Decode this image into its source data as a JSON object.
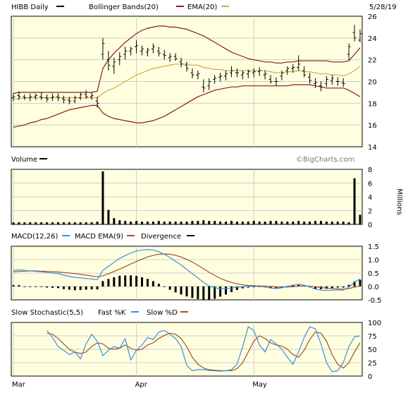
{
  "header": {
    "ticker_label": "HIBB Daily",
    "bollinger_label": "Bollinger Bands(20)",
    "ema_label": "EMA(20)",
    "date": "5/28/19",
    "watermark": "©BigCharts.com"
  },
  "colors": {
    "plot_bg": "#ffffe0",
    "grid": "#cccccc",
    "price_bar": "#000000",
    "bollinger": "#8b1a1a",
    "ema": "#d4a84a",
    "volume_bar": "#000000",
    "macd": "#3a8fe0",
    "macd_ema": "#a0522d",
    "divergence": "#000000",
    "fast_k": "#3a8fe0",
    "slow_d": "#a0522d"
  },
  "panels": {
    "volume_title": "Volume",
    "volume_unit": "Millions",
    "macd_title": "MACD(12,26)",
    "macd_ema_label": "MACD EMA(9)",
    "divergence_label": "Divergence",
    "stoch_title": "Slow Stochastic(5,5)",
    "fast_k_label": "Fast %K",
    "slow_d_label": "Slow %D"
  },
  "x_axis": {
    "labels": [
      {
        "text": "Mar",
        "index": 0
      },
      {
        "text": "Apr",
        "index": 22
      },
      {
        "text": "May",
        "index": 43
      }
    ],
    "n": 63
  },
  "chart_data": [
    {
      "type": "ohlc",
      "title": "HIBB Daily",
      "ylim": [
        14,
        26
      ],
      "yticks": [
        14,
        16,
        18,
        20,
        22,
        24,
        26
      ],
      "ohlc": [
        [
          18.5,
          18.9,
          18.2,
          18.6
        ],
        [
          18.7,
          19.1,
          18.3,
          18.6
        ],
        [
          18.6,
          18.8,
          18.3,
          18.5
        ],
        [
          18.5,
          18.9,
          18.2,
          18.6
        ],
        [
          18.6,
          18.9,
          18.3,
          18.7
        ],
        [
          18.6,
          19.0,
          18.3,
          18.5
        ],
        [
          18.5,
          18.8,
          18.1,
          18.4
        ],
        [
          18.5,
          18.9,
          18.2,
          18.6
        ],
        [
          18.6,
          18.9,
          18.2,
          18.5
        ],
        [
          18.4,
          18.7,
          18.0,
          18.3
        ],
        [
          18.3,
          18.6,
          17.9,
          18.2
        ],
        [
          18.2,
          18.7,
          18.0,
          18.5
        ],
        [
          18.5,
          19.0,
          18.3,
          18.8
        ],
        [
          18.8,
          19.2,
          18.4,
          18.6
        ],
        [
          18.6,
          19.0,
          18.3,
          18.7
        ],
        [
          18.2,
          18.6,
          17.6,
          18.0
        ],
        [
          22.5,
          24.0,
          22.0,
          23.5
        ],
        [
          22.0,
          22.8,
          21.0,
          21.5
        ],
        [
          21.4,
          22.2,
          20.7,
          21.8
        ],
        [
          22.0,
          22.7,
          21.5,
          22.3
        ],
        [
          22.5,
          23.2,
          22.0,
          22.8
        ],
        [
          22.8,
          23.2,
          22.4,
          23.0
        ],
        [
          23.2,
          23.8,
          22.6,
          23.3
        ],
        [
          22.8,
          23.3,
          22.4,
          23.0
        ],
        [
          22.7,
          23.1,
          22.3,
          22.9
        ],
        [
          23.0,
          23.5,
          22.6,
          23.2
        ],
        [
          22.8,
          23.2,
          22.3,
          22.6
        ],
        [
          22.5,
          22.9,
          22.0,
          22.4
        ],
        [
          22.2,
          22.6,
          21.8,
          22.3
        ],
        [
          22.3,
          22.6,
          21.9,
          22.1
        ],
        [
          21.8,
          22.2,
          21.3,
          21.6
        ],
        [
          21.5,
          21.8,
          20.9,
          21.2
        ],
        [
          20.8,
          21.2,
          20.3,
          20.6
        ],
        [
          20.6,
          21.0,
          20.2,
          20.7
        ],
        [
          19.5,
          20.2,
          19.0,
          19.4
        ],
        [
          19.6,
          20.3,
          19.2,
          20.0
        ],
        [
          20.2,
          20.6,
          19.8,
          20.3
        ],
        [
          20.4,
          20.8,
          20.0,
          20.5
        ],
        [
          20.5,
          21.0,
          20.1,
          20.7
        ],
        [
          20.8,
          21.4,
          20.4,
          21.0
        ],
        [
          20.8,
          21.2,
          20.4,
          20.8
        ],
        [
          20.6,
          21.0,
          20.2,
          20.8
        ],
        [
          20.7,
          21.1,
          20.3,
          20.9
        ],
        [
          20.8,
          21.2,
          20.4,
          20.9
        ],
        [
          20.9,
          21.3,
          20.5,
          21.0
        ],
        [
          20.6,
          21.0,
          20.2,
          20.7
        ],
        [
          20.2,
          20.6,
          19.8,
          20.0
        ],
        [
          20.0,
          20.4,
          19.6,
          20.0
        ],
        [
          20.5,
          21.0,
          20.1,
          20.8
        ],
        [
          21.0,
          21.4,
          20.6,
          21.2
        ],
        [
          21.2,
          21.6,
          20.8,
          21.3
        ],
        [
          21.3,
          22.4,
          21.0,
          21.6
        ],
        [
          21.0,
          21.4,
          20.4,
          20.6
        ],
        [
          20.4,
          20.8,
          19.8,
          20.1
        ],
        [
          19.8,
          20.3,
          19.4,
          19.9
        ],
        [
          19.6,
          20.0,
          19.1,
          19.5
        ],
        [
          19.8,
          20.5,
          19.5,
          20.2
        ],
        [
          20.1,
          20.6,
          19.7,
          20.3
        ],
        [
          20.0,
          20.4,
          19.6,
          20.0
        ],
        [
          19.9,
          20.3,
          19.5,
          19.8
        ],
        [
          22.5,
          23.5,
          22.0,
          23.2
        ],
        [
          24.5,
          25.2,
          23.7,
          24.0
        ],
        [
          23.8,
          24.8,
          23.6,
          24.4
        ]
      ],
      "bollinger_upper": [
        18.9,
        19.0,
        19.0,
        19.0,
        19.0,
        19.0,
        19.0,
        19.0,
        19.0,
        19.0,
        19.0,
        19.0,
        19.0,
        19.0,
        19.0,
        19.1,
        21.2,
        22.0,
        22.6,
        23.1,
        23.6,
        24.0,
        24.4,
        24.7,
        24.9,
        25.0,
        25.1,
        25.1,
        25.0,
        25.0,
        24.9,
        24.8,
        24.6,
        24.4,
        24.2,
        23.9,
        23.6,
        23.3,
        23.0,
        22.7,
        22.5,
        22.3,
        22.1,
        22.0,
        21.9,
        21.8,
        21.8,
        21.7,
        21.7,
        21.8,
        21.8,
        21.9,
        21.9,
        21.9,
        21.9,
        21.9,
        21.9,
        21.8,
        21.8,
        21.8,
        21.9,
        22.5,
        23.1
      ],
      "bollinger_lower": [
        15.8,
        15.9,
        16.0,
        16.2,
        16.3,
        16.5,
        16.6,
        16.8,
        17.0,
        17.2,
        17.4,
        17.5,
        17.6,
        17.7,
        17.8,
        17.8,
        17.1,
        16.8,
        16.6,
        16.5,
        16.4,
        16.3,
        16.2,
        16.2,
        16.3,
        16.4,
        16.6,
        16.8,
        17.1,
        17.4,
        17.7,
        18.0,
        18.3,
        18.6,
        18.8,
        19.0,
        19.2,
        19.3,
        19.4,
        19.5,
        19.5,
        19.6,
        19.6,
        19.6,
        19.6,
        19.6,
        19.6,
        19.6,
        19.6,
        19.6,
        19.7,
        19.7,
        19.7,
        19.7,
        19.6,
        19.5,
        19.4,
        19.4,
        19.4,
        19.4,
        19.2,
        18.9,
        18.6
      ],
      "ema": [
        18.4,
        18.4,
        18.5,
        18.5,
        18.5,
        18.5,
        18.5,
        18.5,
        18.5,
        18.5,
        18.5,
        18.5,
        18.5,
        18.5,
        18.5,
        18.5,
        18.9,
        19.2,
        19.4,
        19.7,
        20.0,
        20.3,
        20.6,
        20.8,
        21.0,
        21.2,
        21.3,
        21.4,
        21.5,
        21.6,
        21.6,
        21.6,
        21.5,
        21.5,
        21.3,
        21.2,
        21.1,
        21.1,
        21.0,
        21.0,
        21.0,
        21.0,
        21.0,
        21.0,
        21.0,
        21.0,
        20.9,
        20.8,
        20.8,
        20.9,
        20.9,
        21.0,
        20.9,
        20.9,
        20.8,
        20.7,
        20.7,
        20.6,
        20.6,
        20.5,
        20.7,
        21.0,
        21.4
      ]
    },
    {
      "type": "bar",
      "title": "Volume",
      "ylabel": "Millions",
      "ylim": [
        0,
        8
      ],
      "yticks": [
        0,
        2,
        4,
        6,
        8
      ],
      "values": [
        0.3,
        0.3,
        0.3,
        0.3,
        0.3,
        0.3,
        0.3,
        0.3,
        0.3,
        0.3,
        0.3,
        0.3,
        0.3,
        0.3,
        0.3,
        0.4,
        7.7,
        2.1,
        0.9,
        0.6,
        0.5,
        0.4,
        0.5,
        0.4,
        0.4,
        0.4,
        0.5,
        0.4,
        0.4,
        0.4,
        0.4,
        0.4,
        0.5,
        0.5,
        0.6,
        0.5,
        0.5,
        0.4,
        0.4,
        0.5,
        0.4,
        0.4,
        0.4,
        0.5,
        0.4,
        0.4,
        0.5,
        0.5,
        0.4,
        0.4,
        0.4,
        0.5,
        0.4,
        0.4,
        0.5,
        0.5,
        0.4,
        0.4,
        0.4,
        0.4,
        0.3,
        6.7,
        1.4
      ]
    },
    {
      "type": "line",
      "title": "MACD(12,26)",
      "ylim": [
        -0.5,
        1.5
      ],
      "yticks": [
        -0.5,
        0.0,
        0.5,
        1.0,
        1.5
      ],
      "ytick_labels": [
        "-0.5",
        "0.0",
        "0.5",
        "1.0",
        "1.5"
      ],
      "series": [
        {
          "name": "MACD(12,26)",
          "values": [
            0.6,
            0.62,
            0.6,
            0.58,
            0.56,
            0.55,
            0.52,
            0.5,
            0.48,
            0.42,
            0.38,
            0.34,
            0.32,
            0.3,
            0.28,
            0.25,
            0.6,
            0.75,
            0.9,
            1.05,
            1.15,
            1.25,
            1.32,
            1.36,
            1.38,
            1.36,
            1.3,
            1.2,
            1.08,
            0.94,
            0.8,
            0.64,
            0.48,
            0.32,
            0.15,
            0.02,
            -0.05,
            -0.08,
            -0.08,
            -0.06,
            -0.03,
            -0.01,
            0.0,
            0.0,
            0.01,
            -0.02,
            -0.06,
            -0.08,
            -0.05,
            0.0,
            0.05,
            0.08,
            0.05,
            -0.02,
            -0.1,
            -0.14,
            -0.15,
            -0.14,
            -0.13,
            -0.14,
            -0.02,
            0.16,
            0.28
          ]
        },
        {
          "name": "MACD EMA(9)",
          "values": [
            0.55,
            0.56,
            0.57,
            0.58,
            0.58,
            0.57,
            0.56,
            0.55,
            0.54,
            0.52,
            0.5,
            0.48,
            0.45,
            0.42,
            0.39,
            0.36,
            0.4,
            0.47,
            0.56,
            0.65,
            0.74,
            0.84,
            0.93,
            1.02,
            1.1,
            1.16,
            1.2,
            1.21,
            1.2,
            1.16,
            1.1,
            1.01,
            0.91,
            0.79,
            0.66,
            0.53,
            0.41,
            0.3,
            0.22,
            0.15,
            0.1,
            0.06,
            0.04,
            0.03,
            0.02,
            0.01,
            0.0,
            -0.02,
            -0.03,
            -0.02,
            -0.01,
            0.01,
            0.02,
            0.01,
            -0.01,
            -0.04,
            -0.06,
            -0.08,
            -0.09,
            -0.1,
            -0.08,
            -0.03,
            0.03
          ]
        },
        {
          "name": "Divergence",
          "values": [
            0.05,
            0.05,
            0.0,
            0.0,
            -0.02,
            -0.02,
            -0.04,
            -0.05,
            -0.06,
            -0.1,
            -0.12,
            -0.14,
            -0.13,
            -0.12,
            -0.11,
            -0.11,
            0.2,
            0.28,
            0.34,
            0.4,
            0.41,
            0.41,
            0.39,
            0.34,
            0.28,
            0.2,
            0.1,
            -0.01,
            -0.12,
            -0.22,
            -0.3,
            -0.37,
            -0.43,
            -0.47,
            -0.51,
            -0.51,
            -0.46,
            -0.38,
            -0.3,
            -0.21,
            -0.13,
            -0.07,
            -0.04,
            -0.03,
            -0.01,
            -0.03,
            -0.06,
            -0.06,
            -0.02,
            0.02,
            0.06,
            0.07,
            0.03,
            -0.03,
            -0.09,
            -0.1,
            -0.09,
            -0.06,
            -0.04,
            -0.04,
            0.06,
            0.19,
            0.25
          ]
        }
      ]
    },
    {
      "type": "line",
      "title": "Slow Stochastic(5,5)",
      "ylim": [
        0,
        100
      ],
      "yticks": [
        0,
        25,
        50,
        75,
        100
      ],
      "series": [
        {
          "name": "Fast %K",
          "values": [
            85,
            72,
            55,
            48,
            40,
            45,
            32,
            60,
            78,
            65,
            38,
            48,
            55,
            52,
            70,
            30,
            48,
            58,
            72,
            68,
            82,
            85,
            78,
            70,
            55,
            20,
            10,
            12,
            12,
            10,
            10,
            9,
            10,
            12,
            22,
            55,
            92,
            85,
            58,
            45,
            68,
            60,
            50,
            35,
            22,
            45,
            72,
            92,
            88,
            60,
            25,
            8,
            10,
            25,
            55,
            73,
            75
          ]
        },
        {
          "name": "Slow %D",
          "values": [
            80,
            78,
            70,
            60,
            50,
            45,
            42,
            45,
            55,
            62,
            60,
            52,
            50,
            52,
            58,
            52,
            48,
            50,
            58,
            62,
            70,
            76,
            80,
            78,
            70,
            55,
            35,
            22,
            15,
            12,
            11,
            10,
            10,
            10,
            14,
            25,
            45,
            65,
            75,
            70,
            62,
            58,
            56,
            50,
            40,
            35,
            48,
            68,
            82,
            80,
            65,
            40,
            22,
            15,
            25,
            45,
            62
          ]
        }
      ]
    }
  ]
}
